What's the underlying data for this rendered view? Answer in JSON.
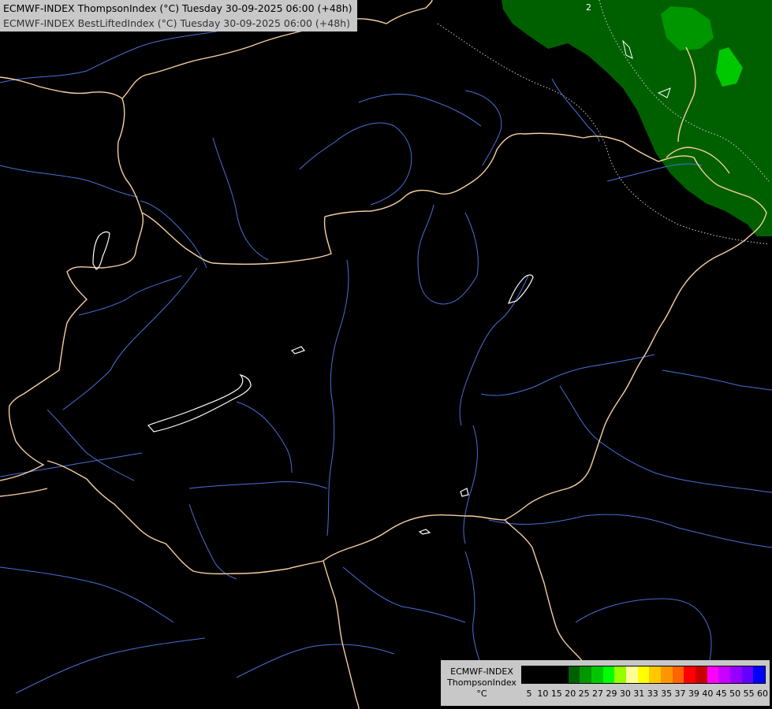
{
  "header": {
    "line1": "ECMWF-INDEX ThompsonIndex (°C) Tuesday 30-09-2025 06:00 (+48h)",
    "line2": "ECMWF-INDEX BestLiftedIndex (°C) Tuesday 30-09-2025 06:00 (+48h)"
  },
  "map": {
    "contour_label": "2",
    "colors": {
      "background": "#000000",
      "border": "#f5cfa0",
      "river": "#4a6fd6",
      "lake": "#ffffff",
      "field_dark": "#006000",
      "field_mid": "#009600",
      "field_bright": "#00c800",
      "contour": "#cfcfcf"
    }
  },
  "legend": {
    "line1": "ECMWF-INDEX",
    "line2": "ThompsonIndex",
    "line3": "°C",
    "ticks": [
      "5",
      "10",
      "15",
      "20",
      "25",
      "27",
      "29",
      "30",
      "31",
      "33",
      "35",
      "37",
      "39",
      "40",
      "45",
      "50",
      "55",
      "60"
    ],
    "colors": [
      "#000000",
      "#000000",
      "#000000",
      "#000000",
      "#005f00",
      "#009600",
      "#00c800",
      "#00ff00",
      "#96ff00",
      "#ffff96",
      "#ffff00",
      "#ffc800",
      "#ff9600",
      "#ff6400",
      "#ff0000",
      "#c80000",
      "#ff00ff",
      "#c800ff",
      "#9600ff",
      "#6400ff",
      "#0000ff"
    ]
  }
}
